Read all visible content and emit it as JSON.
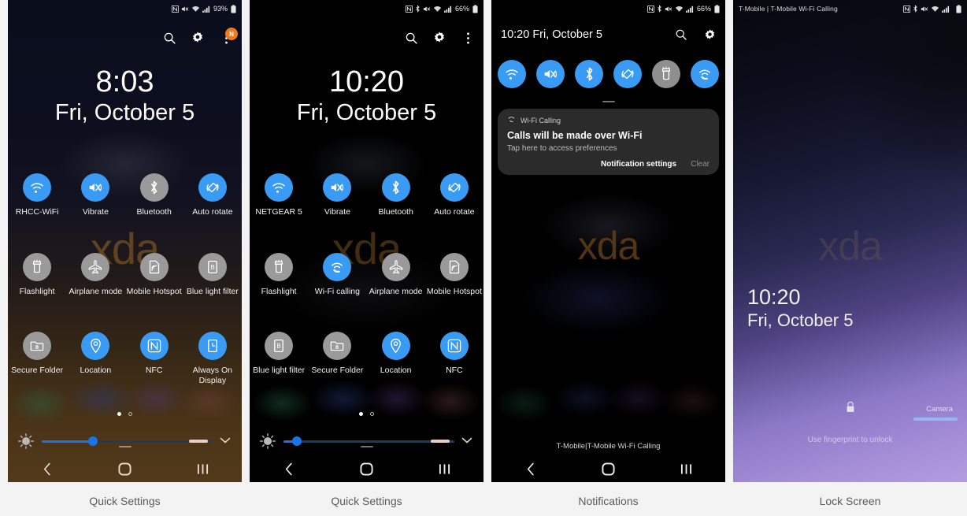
{
  "page": {
    "caption_color": "#5a5a5a",
    "accent_on": "#3a9bf4",
    "accent_off": "#9a9a9a",
    "badge_color": "#f07b1f"
  },
  "panels": [
    {
      "caption": "Quick Settings",
      "statusbar": {
        "carrier": "",
        "battery_text": "93%",
        "icons": [
          "nfc-icon",
          "mute-icon",
          "wifi-icon",
          "signal-icon",
          "battery-icon"
        ]
      },
      "header": {
        "search": "search-icon",
        "gear": "gear-icon",
        "menu": "more-vertical-icon",
        "badge": "N"
      },
      "clock": {
        "time": "8:03",
        "date": "Fri, October 5"
      },
      "tiles": [
        {
          "label": "RHCC-WiFi",
          "icon": "wifi-icon",
          "on": true
        },
        {
          "label": "Vibrate",
          "icon": "vibrate-icon",
          "on": true
        },
        {
          "label": "Bluetooth",
          "icon": "bluetooth-icon",
          "on": false
        },
        {
          "label": "Auto rotate",
          "icon": "auto-rotate-icon",
          "on": true
        },
        {
          "label": "Flashlight",
          "icon": "flashlight-icon",
          "on": false
        },
        {
          "label": "Airplane mode",
          "icon": "airplane-icon",
          "on": false
        },
        {
          "label": "Mobile Hotspot",
          "icon": "hotspot-icon",
          "on": false
        },
        {
          "label": "Blue light filter",
          "icon": "blue-light-icon",
          "on": false
        },
        {
          "label": "Secure Folder",
          "icon": "secure-folder-icon",
          "on": false
        },
        {
          "label": "Location",
          "icon": "location-icon",
          "on": true
        },
        {
          "label": "NFC",
          "icon": "nfc-icon",
          "on": true
        },
        {
          "label": "Always On Display",
          "icon": "always-on-display-icon",
          "on": true
        }
      ],
      "brightness": {
        "value_pct": 30,
        "page": 1,
        "pages": 2
      },
      "navbar": [
        "back-icon",
        "home-icon",
        "recents-icon"
      ]
    },
    {
      "caption": "Quick Settings",
      "statusbar": {
        "carrier": "",
        "battery_text": "66%",
        "icons": [
          "nfc-icon",
          "bluetooth-icon",
          "mute-icon",
          "wifi-icon",
          "signal-icon",
          "battery-icon"
        ]
      },
      "header": {
        "search": "search-icon",
        "gear": "gear-icon",
        "menu": "more-vertical-icon",
        "badge": ""
      },
      "clock": {
        "time": "10:20",
        "date": "Fri, October 5"
      },
      "tiles": [
        {
          "label": "NETGEAR 5",
          "icon": "wifi-icon",
          "on": true
        },
        {
          "label": "Vibrate",
          "icon": "vibrate-icon",
          "on": true
        },
        {
          "label": "Bluetooth",
          "icon": "bluetooth-icon",
          "on": true
        },
        {
          "label": "Auto rotate",
          "icon": "auto-rotate-icon",
          "on": true
        },
        {
          "label": "Flashlight",
          "icon": "flashlight-icon",
          "on": false
        },
        {
          "label": "Wi-Fi calling",
          "icon": "wifi-calling-icon",
          "on": true
        },
        {
          "label": "Airplane mode",
          "icon": "airplane-icon",
          "on": false
        },
        {
          "label": "Mobile Hotspot",
          "icon": "hotspot-icon",
          "on": false
        },
        {
          "label": "Blue light filter",
          "icon": "blue-light-icon",
          "on": false
        },
        {
          "label": "Secure Folder",
          "icon": "secure-folder-icon",
          "on": false
        },
        {
          "label": "Location",
          "icon": "location-icon",
          "on": true
        },
        {
          "label": "NFC",
          "icon": "nfc-icon",
          "on": true
        }
      ],
      "brightness": {
        "value_pct": 8,
        "page": 1,
        "pages": 2
      },
      "navbar": [
        "back-icon",
        "home-icon",
        "recents-icon"
      ]
    },
    {
      "caption": "Notifications",
      "statusbar": {
        "carrier": "",
        "battery_text": "66%",
        "icons": [
          "nfc-icon",
          "bluetooth-icon",
          "mute-icon",
          "wifi-icon",
          "signal-icon",
          "battery-icon"
        ]
      },
      "header": {
        "datetime": "10:20  Fri, October 5",
        "search": "search-icon",
        "gear": "gear-icon"
      },
      "quick_toggles": [
        {
          "icon": "wifi-icon",
          "on": true
        },
        {
          "icon": "vibrate-icon",
          "on": true
        },
        {
          "icon": "bluetooth-icon",
          "on": true
        },
        {
          "icon": "auto-rotate-icon",
          "on": true
        },
        {
          "icon": "flashlight-icon",
          "on": false
        },
        {
          "icon": "wifi-calling-icon",
          "on": true
        }
      ],
      "notification": {
        "app": "Wi-Fi Calling",
        "app_icon": "wifi-calling-icon",
        "title": "Calls will be made over Wi-Fi",
        "body": "Tap here to access preferences",
        "action_primary": "Notification settings",
        "action_secondary": "Clear"
      },
      "carrier_footer": "T-Mobile|T-Mobile Wi-Fi Calling",
      "navbar": [
        "back-icon",
        "home-icon",
        "recents-icon"
      ]
    },
    {
      "caption": "Lock Screen",
      "statusbar": {
        "carrier": "T-Mobile | T-Mobile Wi-Fi Calling",
        "battery_text": "",
        "icons": [
          "nfc-icon",
          "bluetooth-icon",
          "mute-icon",
          "wifi-icon",
          "signal-icon",
          "battery-icon"
        ]
      },
      "clock": {
        "time": "10:20",
        "date": "Fri, October 5"
      },
      "lock_icon": "lock-icon",
      "hint": "Use fingerprint to unlock",
      "camera_label": "Camera"
    }
  ]
}
